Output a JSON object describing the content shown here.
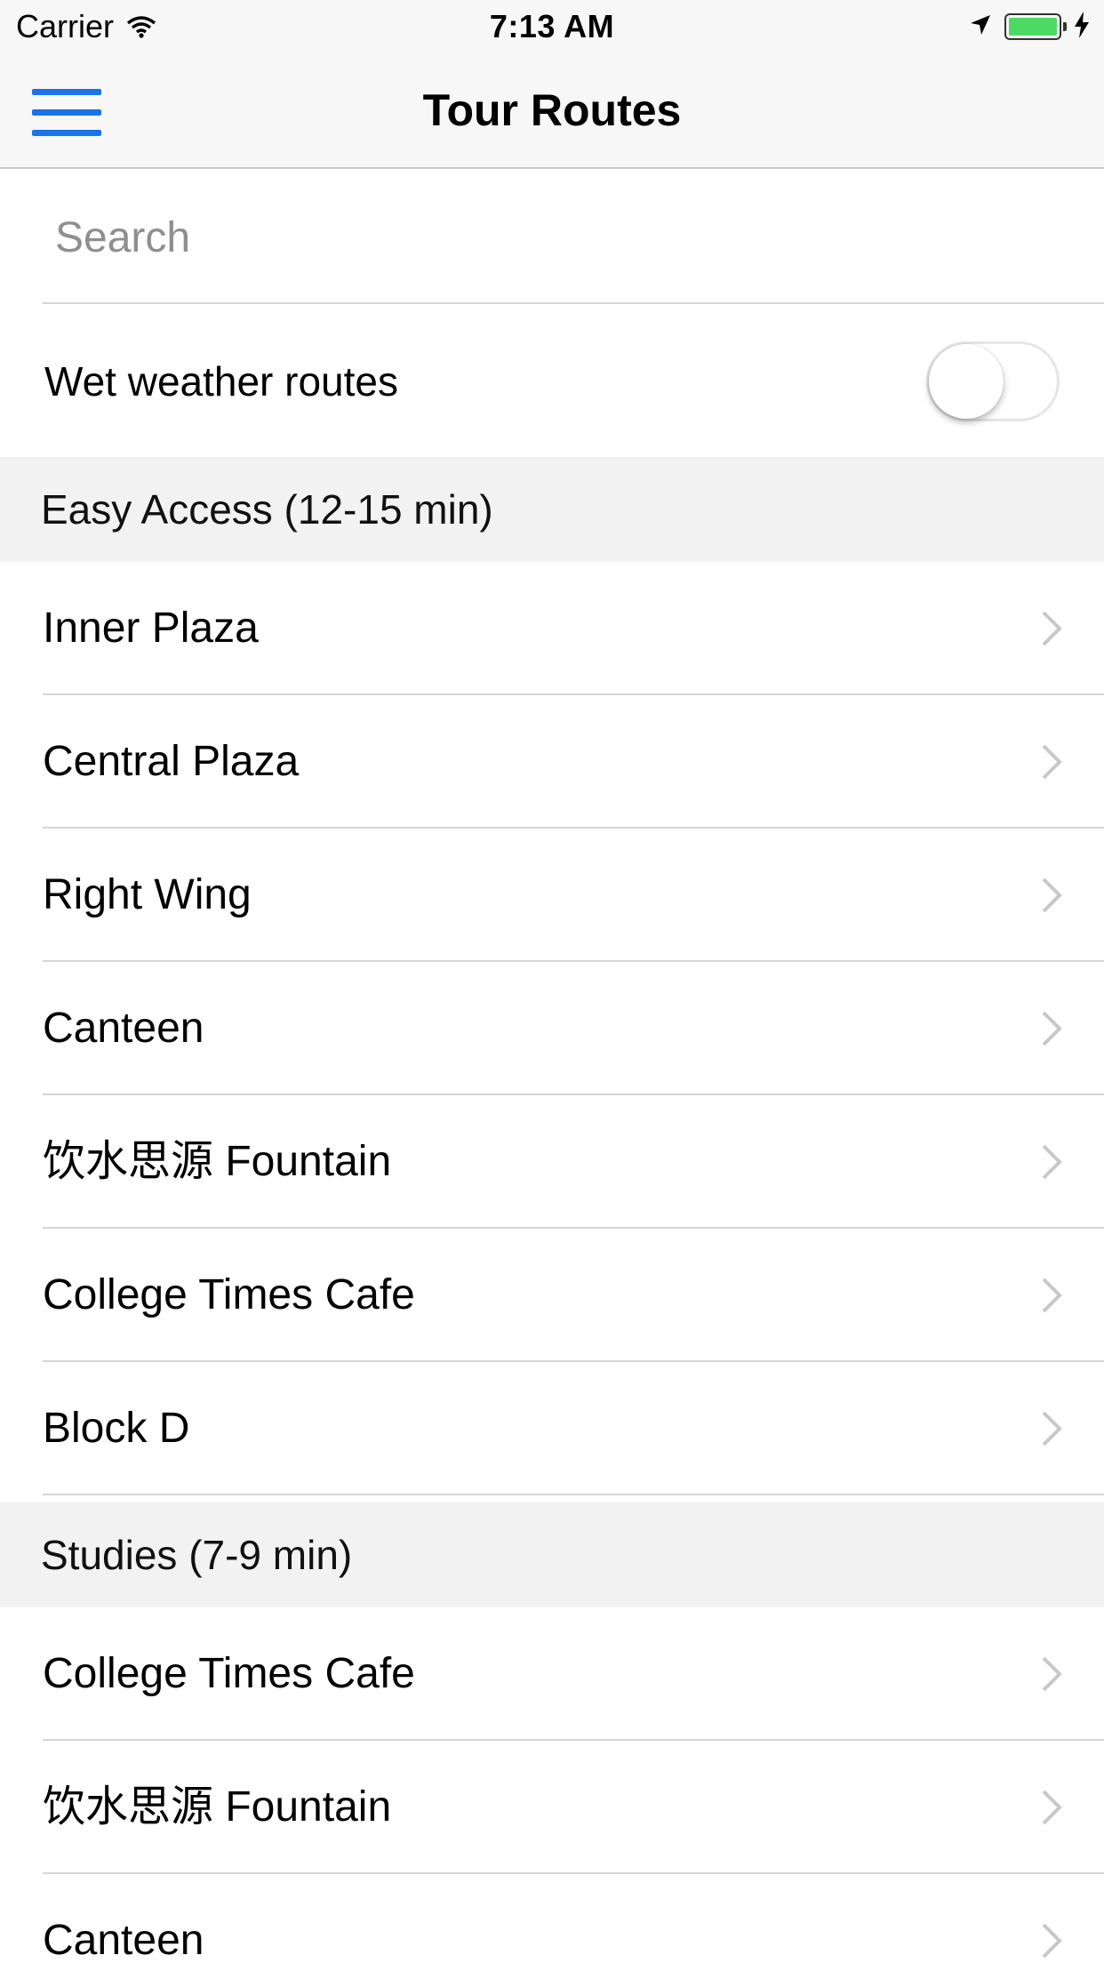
{
  "status_bar": {
    "carrier": "Carrier",
    "time": "7:13 AM",
    "battery_color": "#4cd964"
  },
  "nav": {
    "title": "Tour Routes",
    "menu_icon": "hamburger-icon"
  },
  "search": {
    "placeholder": "Search",
    "value": ""
  },
  "wet_weather": {
    "label": "Wet weather routes",
    "enabled": false
  },
  "sections": [
    {
      "header": "Easy Access (12-15 min)",
      "items": [
        "Inner Plaza",
        "Central Plaza",
        "Right Wing",
        "Canteen",
        "饮水思源 Fountain",
        "College Times Cafe",
        "Block D"
      ]
    },
    {
      "header": "Studies (7-9 min)",
      "items": [
        "College Times Cafe",
        "饮水思源 Fountain",
        "Canteen"
      ]
    }
  ],
  "colors": {
    "accent": "#1a73e8",
    "section_bg": "#f2f2f2",
    "separator": "#d6d6da",
    "chevron": "#c7c7cc"
  }
}
